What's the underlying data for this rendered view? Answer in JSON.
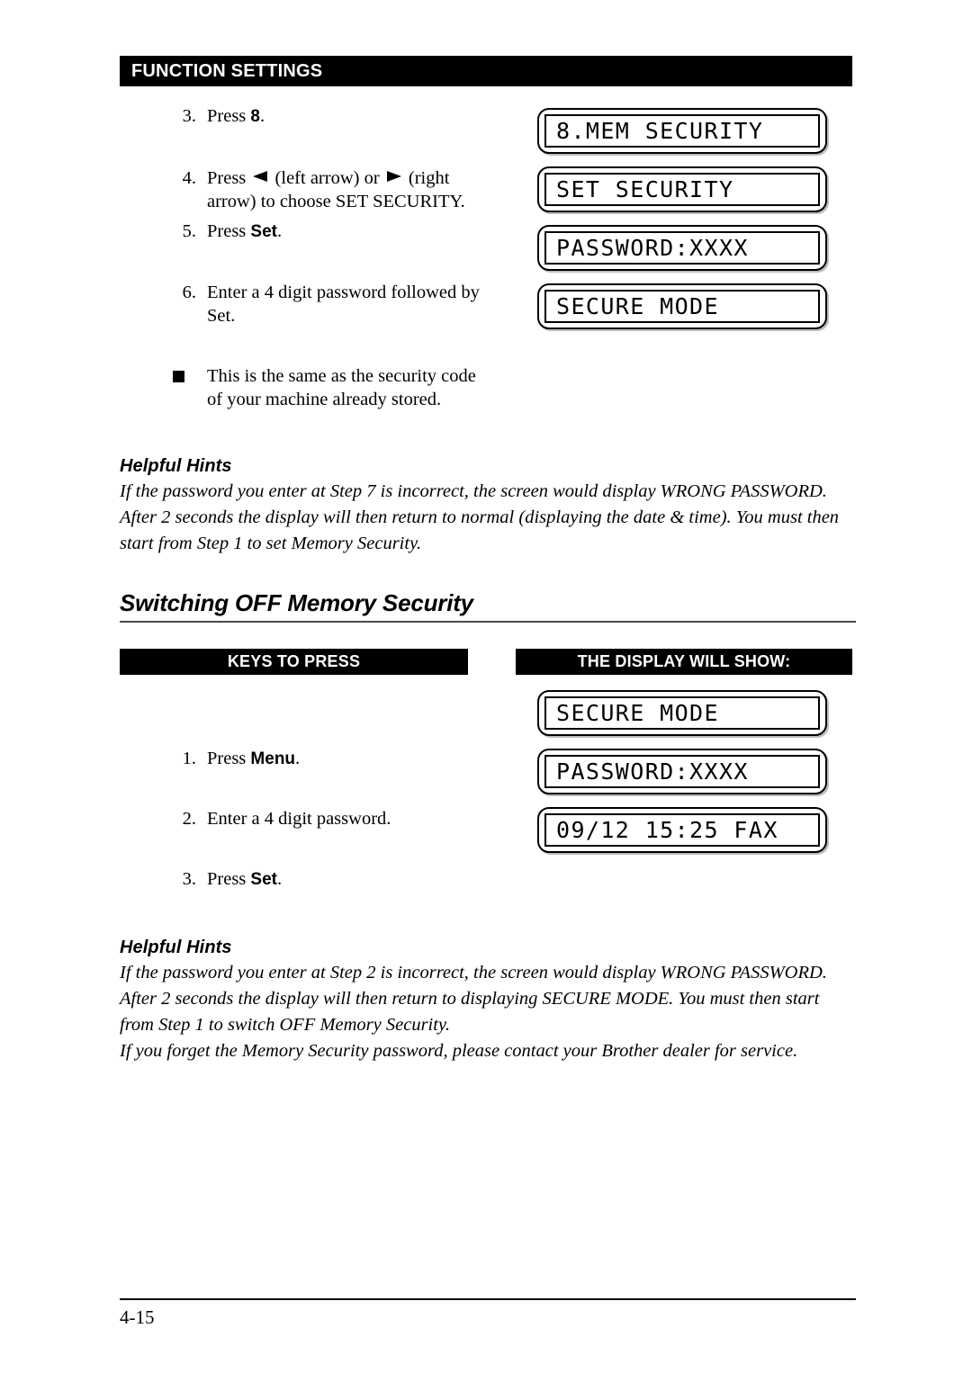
{
  "header": {
    "function_settings_label": "FUNCTION SETTINGS"
  },
  "section_on": {
    "steps": [
      {
        "num": "3.",
        "text_before": "Press ",
        "key": "8",
        "text_after": "."
      },
      {
        "num": "4.",
        "text_line1_a": "Press ",
        "arrow_left": "left-arrow",
        "text_line1_b": " (left arrow) or ",
        "arrow_right": "right-arrow",
        "text_line1_c": " (right",
        "text_line2": "arrow) to choose SET SECURITY."
      },
      {
        "num": "5.",
        "text_before": "Press ",
        "key": "Set",
        "text_after": "."
      },
      {
        "num": "6.",
        "text_line1": "Enter a 4 digit password followed by",
        "text_line2": "Set."
      }
    ],
    "note": {
      "line1": "This is the same as the security code",
      "line2": "of your machine already stored."
    },
    "displays": [
      "8.MEM SECURITY",
      "SET SECURITY",
      "PASSWORD:XXXX",
      "SECURE MODE"
    ],
    "hints": {
      "title": "Helpful Hints",
      "body": "If the password you enter at Step 7 is incorrect, the screen would display WRONG PASSWORD. After 2 seconds the display will then return to normal (displaying the date & time). You must then start from Step 1 to set Memory Security."
    }
  },
  "section_off": {
    "heading": "Switching OFF Memory Security",
    "column_headers": {
      "keys": "KEYS TO PRESS",
      "display": "THE DISPLAY WILL SHOW:"
    },
    "steps": [
      {
        "num": "1.",
        "text_before": "Press ",
        "key": "Menu",
        "text_after": "."
      },
      {
        "num": "2.",
        "text": "Enter a 4 digit password."
      },
      {
        "num": "3.",
        "text_before": "Press ",
        "key": "Set",
        "text_after": "."
      }
    ],
    "displays": [
      "SECURE MODE",
      "PASSWORD:XXXX",
      "09/12 15:25 FAX"
    ],
    "hints": {
      "title": "Helpful Hints",
      "body_1": "If the password you enter at Step 2 is incorrect, the screen would display WRONG PASSWORD. After 2 seconds the display will then return to displaying SECURE MODE. You must then start from Step 1 to switch OFF Memory Security.",
      "body_2": "If you forget the Memory Security password, please contact your Brother dealer for service."
    }
  },
  "footer": {
    "page_number": "4-15"
  },
  "colors": {
    "bar_background": "#000000",
    "bar_text": "#ffffff",
    "body_text": "#000000",
    "rule": "#4a4a4a"
  }
}
